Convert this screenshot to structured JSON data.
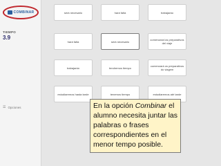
{
  "sidebar": {
    "logo_text": "COMBINAR",
    "time_label": "TIEMPO",
    "time_value": "3.9",
    "options_label": "Opciones"
  },
  "cards": [
    [
      "será necesario",
      "hará falta",
      "trabajaráo"
    ],
    [
      "hará falta",
      "será necesario",
      "comenzará los preparativos del viaje"
    ],
    [
      "trabajarán",
      "tendremos tiempo",
      "comenzará os preparativos do viagem"
    ],
    [
      "estudiaremos hasta tarde",
      "tenemos tiempo",
      "estudiaremos até tarde"
    ]
  ],
  "caption": {
    "part1": "En la opción ",
    "emph": "Combinar",
    "part2": " el alumno necesita juntar las palabras o frases correspondientes en el menor tempo posible."
  },
  "colors": {
    "accent_red": "#c0272d",
    "brand_blue": "#2c5f9e",
    "caption_bg": "#fff4c8"
  }
}
